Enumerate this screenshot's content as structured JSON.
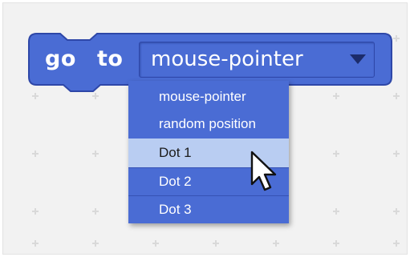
{
  "block": {
    "word_go": "go",
    "word_to": "to",
    "selected_value": "mouse-pointer",
    "icon": "chevron-down-icon"
  },
  "menu": {
    "items": [
      {
        "label": "mouse-pointer",
        "selected": false
      },
      {
        "label": "random position",
        "selected": false
      },
      {
        "label": "Dot 1",
        "selected": true
      },
      {
        "label": "Dot 2",
        "selected": false
      },
      {
        "label": "Dot 3",
        "selected": false
      }
    ]
  },
  "cursor": {
    "icon": "mouse-cursor-icon"
  },
  "colors": {
    "block_fill": "#4a6cd4",
    "block_border": "#2e47a8",
    "menu_fill": "#4a6cd4",
    "menu_highlight": "#b9cdf2",
    "canvas_bg": "#f2f2f2",
    "grid_mark": "#d9d9d9"
  }
}
